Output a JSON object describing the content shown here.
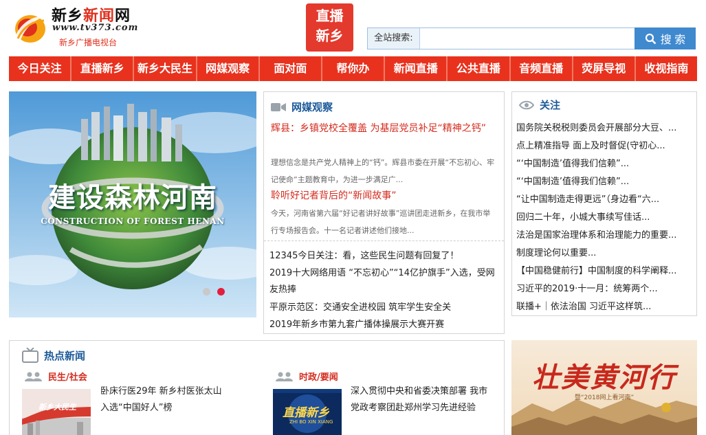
{
  "header": {
    "site_name_a": "新乡",
    "site_name_b": "新闻",
    "site_name_c": "网",
    "site_url": "www.tv373.com",
    "site_subtitle": "新乡广播电视台",
    "live_badge_line1": "直播",
    "live_badge_line2": "新乡",
    "search_label": "全站搜索:",
    "search_value": "",
    "search_button": "搜 索"
  },
  "nav": {
    "items": [
      "今日关注",
      "直播新乡",
      "新乡大民生",
      "网媒观察",
      "面对面",
      "帮你办",
      "新闻直播",
      "公共直播",
      "音频直播",
      "荧屏导视",
      "收视指南"
    ]
  },
  "slider": {
    "title": "建设森林河南",
    "subtitle": "CONSTRUCTION OF FOREST HENAN"
  },
  "media": {
    "title": "网媒观察",
    "headline1": "辉县：乡镇党校全覆盖 为基层党员补足“精神之钙”",
    "summary1": "理想信念是共产党人精神上的“钙”。辉县市委在开展“不忘初心、牢记使命”主题教育中，为进一步满足广...",
    "headline2": "聆听好记者背后的“新闻故事”",
    "summary2": "今天，河南省第六届“好记者讲好故事”巡讲团走进新乡，在我市举行专场报告会。十一名记者讲述他们接地...",
    "links": [
      "12345今日关注：看，这些民生问题有回复了！",
      "2019十大网络用语 “不忘初心”“14亿护旗手”入选，受网友热捧",
      "平原示范区：交通安全进校园 筑牢学生安全关",
      "2019年新乡市第九套广播体操展示大赛开赛"
    ]
  },
  "focus": {
    "title": "关注",
    "items": [
      "国务院关税税则委员会开展部分大豆、...",
      "点上精准指导 面上及时督促(守初心...",
      "“‘中国制造’值得我们信赖”...",
      "“‘中国制造’值得我们信赖”...",
      "“让中国制造走得更远”（身边看“六...",
      "回归二十年，小城大事续写佳话...",
      "法治是国家治理体系和治理能力的重要...",
      "制度理论何以重要...",
      "【中国稳健前行】中国制度的科学阐释...",
      "习近平的2019·十一月：统筹两个...",
      "联播+｜依法治国 习近平这样筑..."
    ]
  },
  "hot": {
    "title": "热点新闻",
    "cat1": "民生/社会",
    "cat1_text": "卧床行医29年 新乡村医张太山入选“中国好人”榜",
    "cat1_thumb_text": "新乡大民生",
    "cat2": "时政/要闻",
    "cat2_text": "深入贯彻中央和省委决策部署 我市党政考察团赴郑州学习先进经验",
    "cat2_thumb_text": "直播新乡",
    "cat2_thumb_sub": "ZHI BO XIN XIANG"
  },
  "banner": {
    "title": "壮美黄河行",
    "subtitle": "暨“2018网上看河南”"
  }
}
